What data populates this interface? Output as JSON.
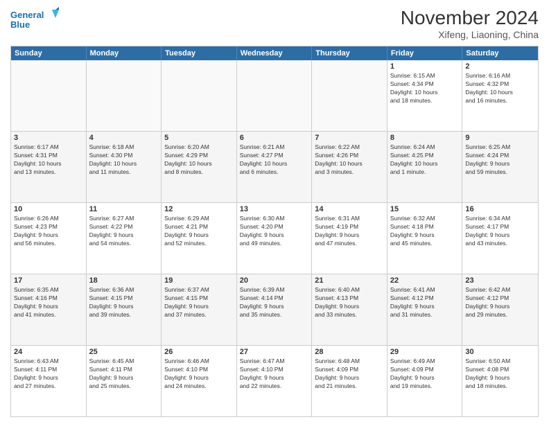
{
  "logo": {
    "line1": "General",
    "line2": "Blue"
  },
  "title": "November 2024",
  "subtitle": "Xifeng, Liaoning, China",
  "header_days": [
    "Sunday",
    "Monday",
    "Tuesday",
    "Wednesday",
    "Thursday",
    "Friday",
    "Saturday"
  ],
  "weeks": [
    [
      {
        "day": "",
        "info": "",
        "empty": true
      },
      {
        "day": "",
        "info": "",
        "empty": true
      },
      {
        "day": "",
        "info": "",
        "empty": true
      },
      {
        "day": "",
        "info": "",
        "empty": true
      },
      {
        "day": "",
        "info": "",
        "empty": true
      },
      {
        "day": "1",
        "info": "Sunrise: 6:15 AM\nSunset: 4:34 PM\nDaylight: 10 hours\nand 18 minutes."
      },
      {
        "day": "2",
        "info": "Sunrise: 6:16 AM\nSunset: 4:32 PM\nDaylight: 10 hours\nand 16 minutes."
      }
    ],
    [
      {
        "day": "3",
        "info": "Sunrise: 6:17 AM\nSunset: 4:31 PM\nDaylight: 10 hours\nand 13 minutes."
      },
      {
        "day": "4",
        "info": "Sunrise: 6:18 AM\nSunset: 4:30 PM\nDaylight: 10 hours\nand 11 minutes."
      },
      {
        "day": "5",
        "info": "Sunrise: 6:20 AM\nSunset: 4:29 PM\nDaylight: 10 hours\nand 8 minutes."
      },
      {
        "day": "6",
        "info": "Sunrise: 6:21 AM\nSunset: 4:27 PM\nDaylight: 10 hours\nand 6 minutes."
      },
      {
        "day": "7",
        "info": "Sunrise: 6:22 AM\nSunset: 4:26 PM\nDaylight: 10 hours\nand 3 minutes."
      },
      {
        "day": "8",
        "info": "Sunrise: 6:24 AM\nSunset: 4:25 PM\nDaylight: 10 hours\nand 1 minute."
      },
      {
        "day": "9",
        "info": "Sunrise: 6:25 AM\nSunset: 4:24 PM\nDaylight: 9 hours\nand 59 minutes."
      }
    ],
    [
      {
        "day": "10",
        "info": "Sunrise: 6:26 AM\nSunset: 4:23 PM\nDaylight: 9 hours\nand 56 minutes."
      },
      {
        "day": "11",
        "info": "Sunrise: 6:27 AM\nSunset: 4:22 PM\nDaylight: 9 hours\nand 54 minutes."
      },
      {
        "day": "12",
        "info": "Sunrise: 6:29 AM\nSunset: 4:21 PM\nDaylight: 9 hours\nand 52 minutes."
      },
      {
        "day": "13",
        "info": "Sunrise: 6:30 AM\nSunset: 4:20 PM\nDaylight: 9 hours\nand 49 minutes."
      },
      {
        "day": "14",
        "info": "Sunrise: 6:31 AM\nSunset: 4:19 PM\nDaylight: 9 hours\nand 47 minutes."
      },
      {
        "day": "15",
        "info": "Sunrise: 6:32 AM\nSunset: 4:18 PM\nDaylight: 9 hours\nand 45 minutes."
      },
      {
        "day": "16",
        "info": "Sunrise: 6:34 AM\nSunset: 4:17 PM\nDaylight: 9 hours\nand 43 minutes."
      }
    ],
    [
      {
        "day": "17",
        "info": "Sunrise: 6:35 AM\nSunset: 4:16 PM\nDaylight: 9 hours\nand 41 minutes."
      },
      {
        "day": "18",
        "info": "Sunrise: 6:36 AM\nSunset: 4:15 PM\nDaylight: 9 hours\nand 39 minutes."
      },
      {
        "day": "19",
        "info": "Sunrise: 6:37 AM\nSunset: 4:15 PM\nDaylight: 9 hours\nand 37 minutes."
      },
      {
        "day": "20",
        "info": "Sunrise: 6:39 AM\nSunset: 4:14 PM\nDaylight: 9 hours\nand 35 minutes."
      },
      {
        "day": "21",
        "info": "Sunrise: 6:40 AM\nSunset: 4:13 PM\nDaylight: 9 hours\nand 33 minutes."
      },
      {
        "day": "22",
        "info": "Sunrise: 6:41 AM\nSunset: 4:12 PM\nDaylight: 9 hours\nand 31 minutes."
      },
      {
        "day": "23",
        "info": "Sunrise: 6:42 AM\nSunset: 4:12 PM\nDaylight: 9 hours\nand 29 minutes."
      }
    ],
    [
      {
        "day": "24",
        "info": "Sunrise: 6:43 AM\nSunset: 4:11 PM\nDaylight: 9 hours\nand 27 minutes."
      },
      {
        "day": "25",
        "info": "Sunrise: 6:45 AM\nSunset: 4:11 PM\nDaylight: 9 hours\nand 25 minutes."
      },
      {
        "day": "26",
        "info": "Sunrise: 6:46 AM\nSunset: 4:10 PM\nDaylight: 9 hours\nand 24 minutes."
      },
      {
        "day": "27",
        "info": "Sunrise: 6:47 AM\nSunset: 4:10 PM\nDaylight: 9 hours\nand 22 minutes."
      },
      {
        "day": "28",
        "info": "Sunrise: 6:48 AM\nSunset: 4:09 PM\nDaylight: 9 hours\nand 21 minutes."
      },
      {
        "day": "29",
        "info": "Sunrise: 6:49 AM\nSunset: 4:09 PM\nDaylight: 9 hours\nand 19 minutes."
      },
      {
        "day": "30",
        "info": "Sunrise: 6:50 AM\nSunset: 4:08 PM\nDaylight: 9 hours\nand 18 minutes."
      }
    ]
  ]
}
